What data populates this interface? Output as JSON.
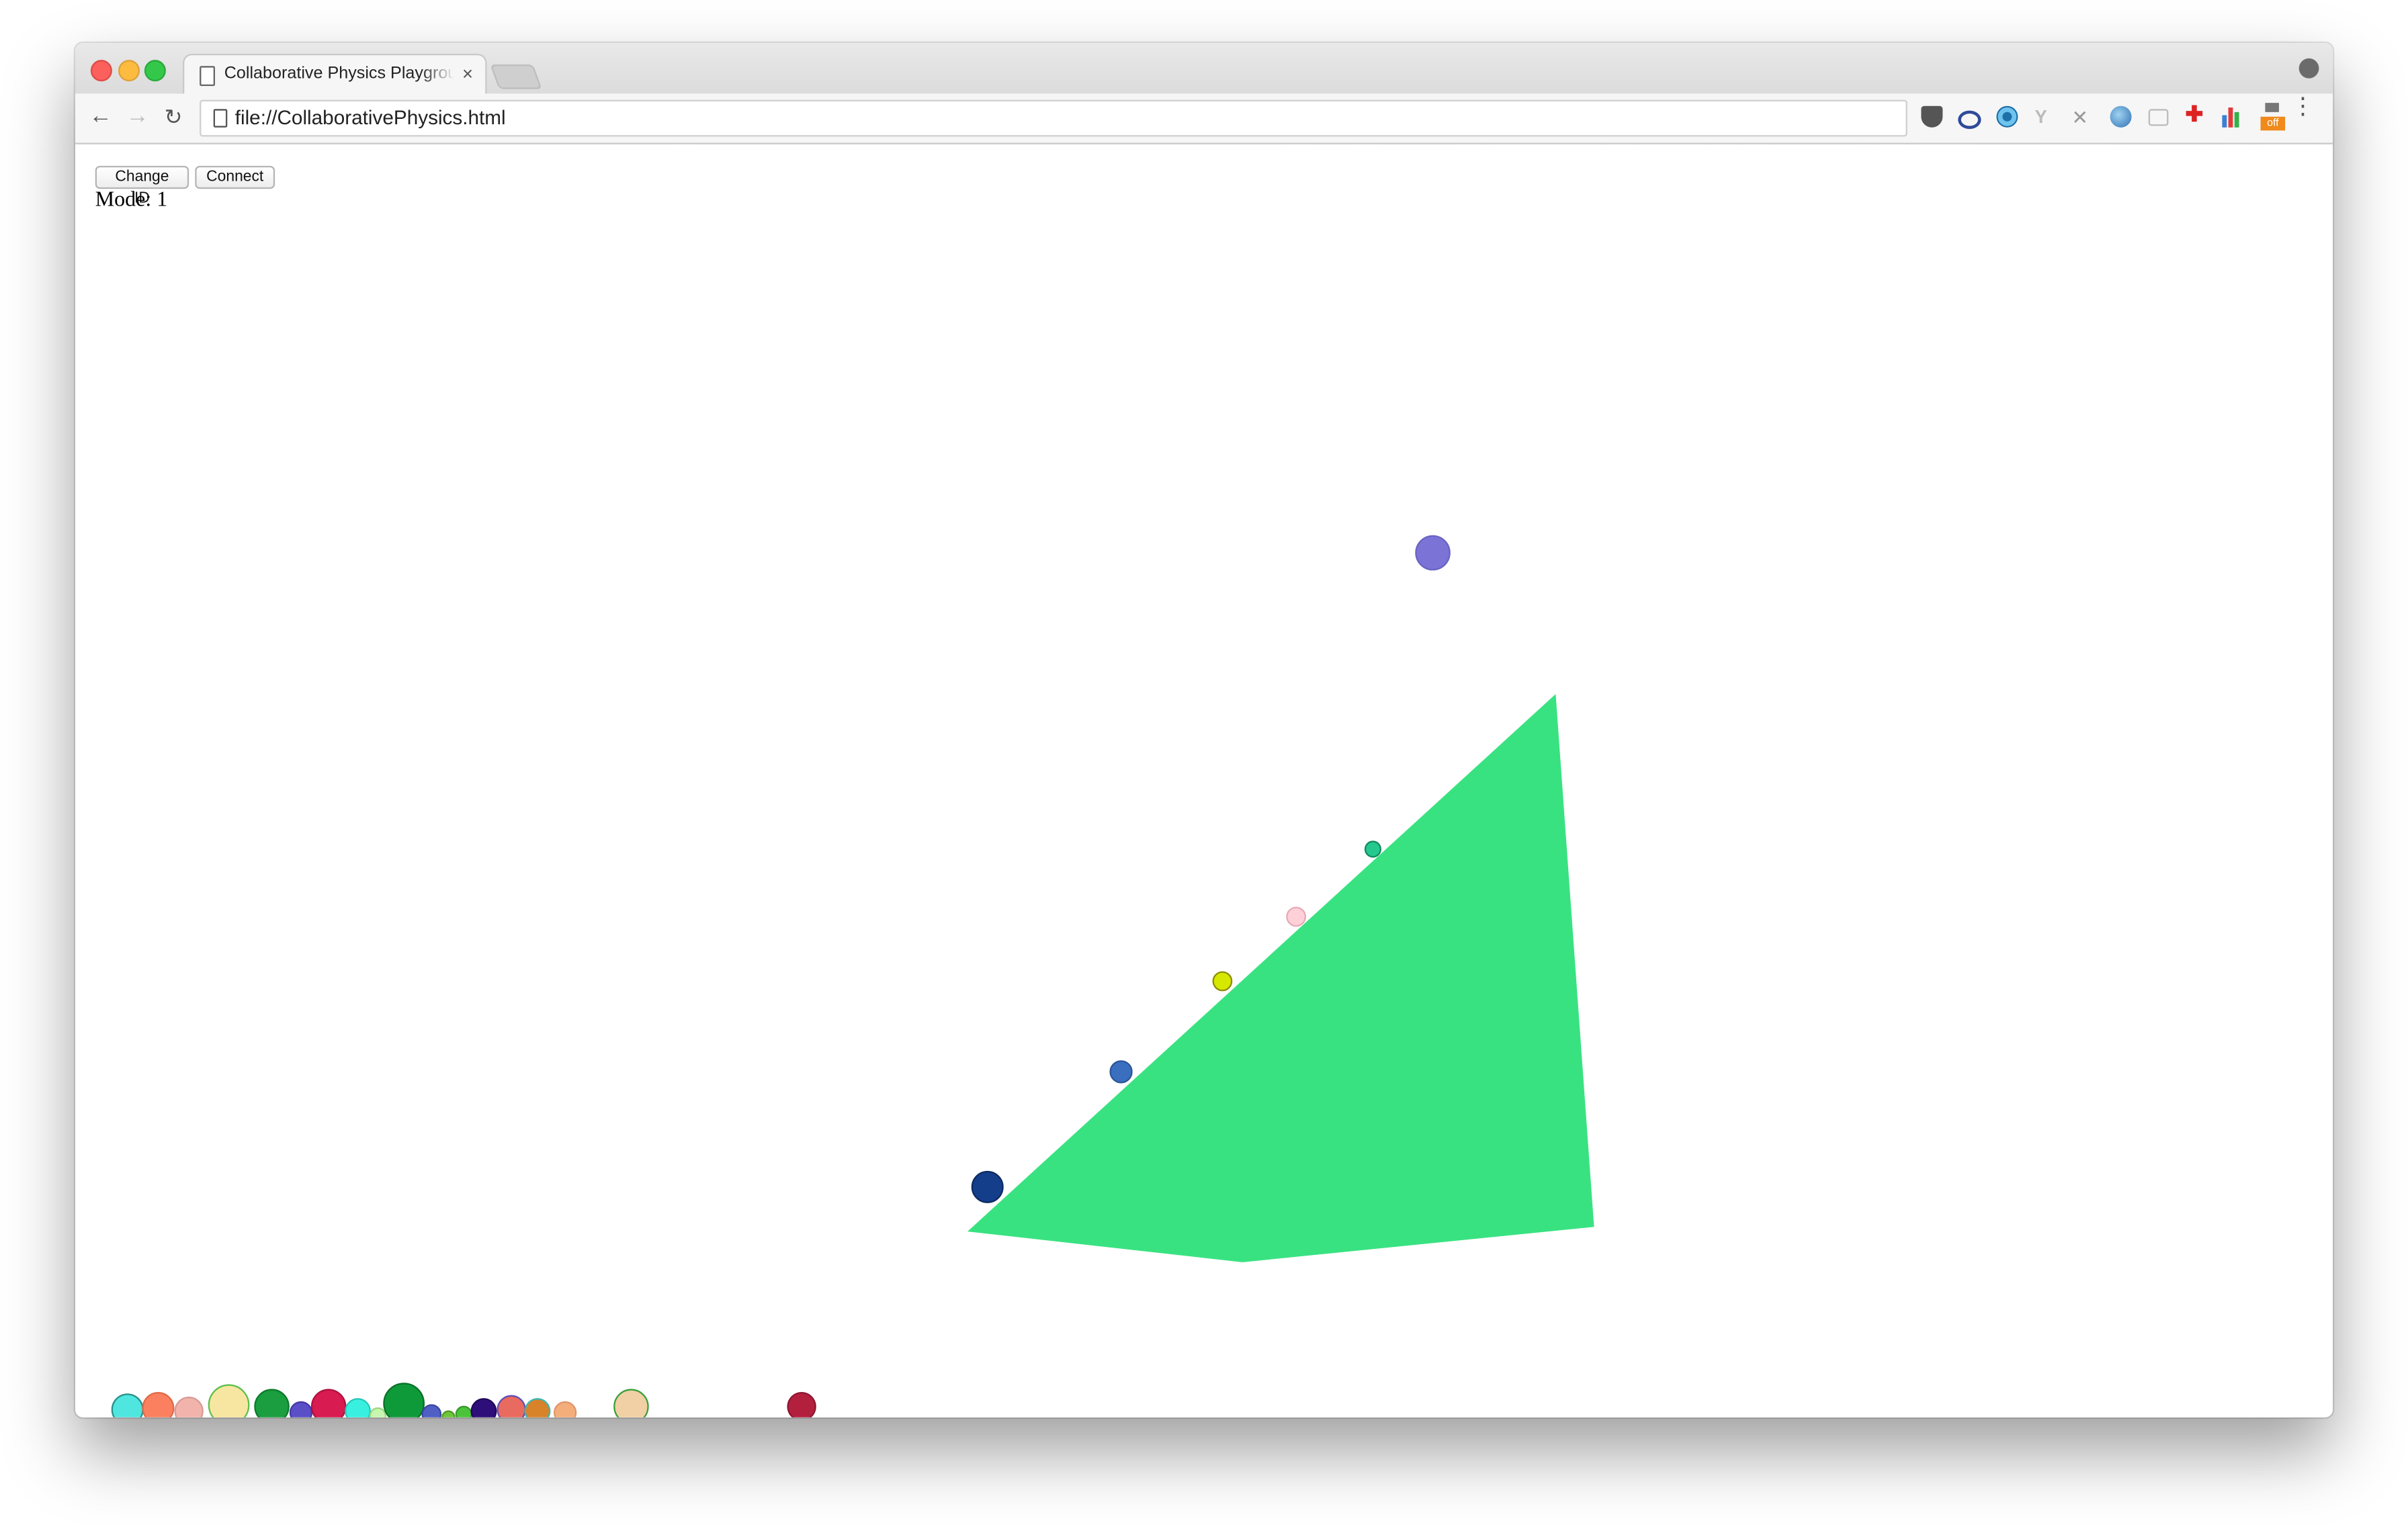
{
  "browser": {
    "tab_title": "Collaborative Physics Playground",
    "tab_close": "×",
    "url": "file://CollaborativePhysics.html",
    "extension_badge": "off",
    "nav": {
      "back": "←",
      "forward": "→",
      "reload": "↻",
      "menu": "⋮"
    }
  },
  "page": {
    "change_id_label": "Change ID",
    "connect_label": "Connect",
    "mode_text": "Mode: 1"
  },
  "scene": {
    "polygon_color": "#39e281",
    "balls": [
      {
        "name": "ball-blue-purple",
        "color": "#7b73d6",
        "stroke": "#6a63c4"
      },
      {
        "name": "ball-teal",
        "color": "#25c98f",
        "stroke": "#138a60"
      },
      {
        "name": "ball-pink",
        "color": "#ffd0d8",
        "stroke": "#e6aab5"
      },
      {
        "name": "ball-yellow",
        "color": "#d6e800",
        "stroke": "#8a8f00"
      },
      {
        "name": "ball-steel-blue",
        "color": "#3a6fbf",
        "stroke": "#2b559a"
      },
      {
        "name": "ball-navy",
        "color": "#153e8a",
        "stroke": "#0c2a63"
      },
      {
        "name": "ball-cyan",
        "color": "#4fe6e0",
        "stroke": "#2a8f8a"
      },
      {
        "name": "ball-salmon",
        "color": "#fb8060",
        "stroke": "#e06a48"
      },
      {
        "name": "ball-rose",
        "color": "#f2b3ad",
        "stroke": "#d79b95"
      },
      {
        "name": "ball-cream",
        "color": "#f7e6a1",
        "stroke": "#5cc04a"
      },
      {
        "name": "ball-green",
        "color": "#1a9e3f",
        "stroke": "#0d7a2c"
      },
      {
        "name": "ball-indigo",
        "color": "#5a4fc7",
        "stroke": "#4338a8"
      },
      {
        "name": "ball-crimson",
        "color": "#d81b50",
        "stroke": "#b01040"
      },
      {
        "name": "ball-aqua",
        "color": "#39f0e0",
        "stroke": "#22c9b8"
      },
      {
        "name": "ball-pale-green",
        "color": "#c8f5b0",
        "stroke": "#9ad67e"
      },
      {
        "name": "ball-forest",
        "color": "#0f9a3a",
        "stroke": "#087028"
      },
      {
        "name": "ball-slate-blue",
        "color": "#4f5fc4",
        "stroke": "#3a47a0"
      },
      {
        "name": "ball-lime",
        "color": "#6cc63a",
        "stroke": "#4f9a26"
      },
      {
        "name": "ball-grass",
        "color": "#4bc43b",
        "stroke": "#3a9a2c"
      },
      {
        "name": "ball-deep-purple",
        "color": "#2e0f7a",
        "stroke": "#1e0858"
      },
      {
        "name": "ball-coral",
        "color": "#e96a5e",
        "stroke": "#5f4fb8"
      },
      {
        "name": "ball-orange",
        "color": "#d8822a",
        "stroke": "#38b8b0"
      },
      {
        "name": "ball-peach",
        "color": "#f4ae7c",
        "stroke": "#e0946a"
      },
      {
        "name": "ball-tan",
        "color": "#f0d0a4",
        "stroke": "#3aa03a"
      },
      {
        "name": "ball-maroon",
        "color": "#b3203e",
        "stroke": "#8e1530"
      }
    ]
  }
}
